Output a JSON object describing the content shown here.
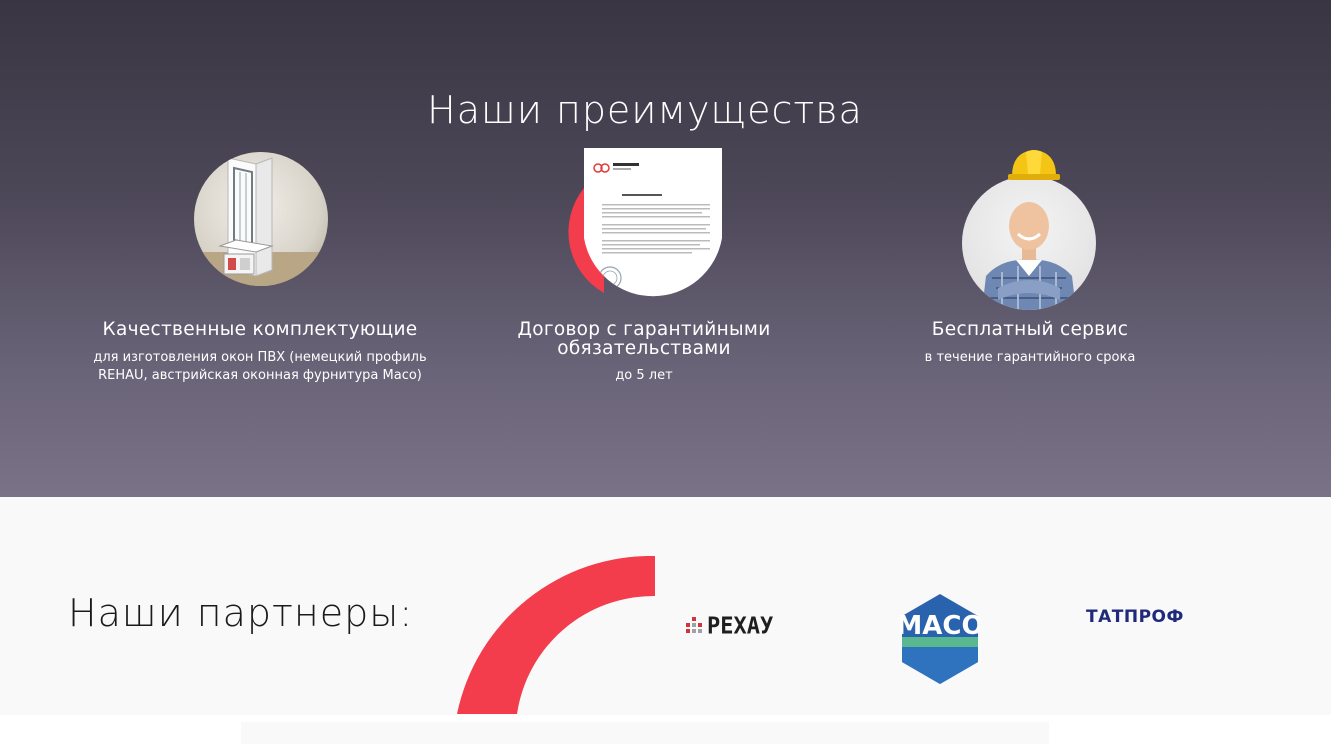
{
  "advantages": {
    "title": "Наши преимущества",
    "items": [
      {
        "heading": "Качественные комплектующие",
        "description": "для изготовления окон ПВХ (немецкий профиль REHAU, австрийская оконная фурнитура Maco)",
        "icon": "pvc-window-profile-image"
      },
      {
        "heading": "Договор с гарантийными обязательствами",
        "description": "до 5 лет",
        "icon": "contract-document-image"
      },
      {
        "heading": "Бесплатный сервис",
        "description": "в течение гарантийного срока",
        "icon": "worker-in-helmet-image"
      }
    ]
  },
  "partners": {
    "title": "Наши партнеры:",
    "logos": [
      {
        "name": "РЕХАУ",
        "icon": "rehau-logo"
      },
      {
        "name": "MACO",
        "icon": "maco-logo"
      },
      {
        "name": "ТАТПРОФ",
        "icon": "tatprof-logo"
      }
    ]
  },
  "colors": {
    "accent_red": "#f33c4c",
    "maco_blue": "#2a63ad",
    "maco_green": "#59b88f",
    "tatprof_blue": "#1f2a7a"
  }
}
